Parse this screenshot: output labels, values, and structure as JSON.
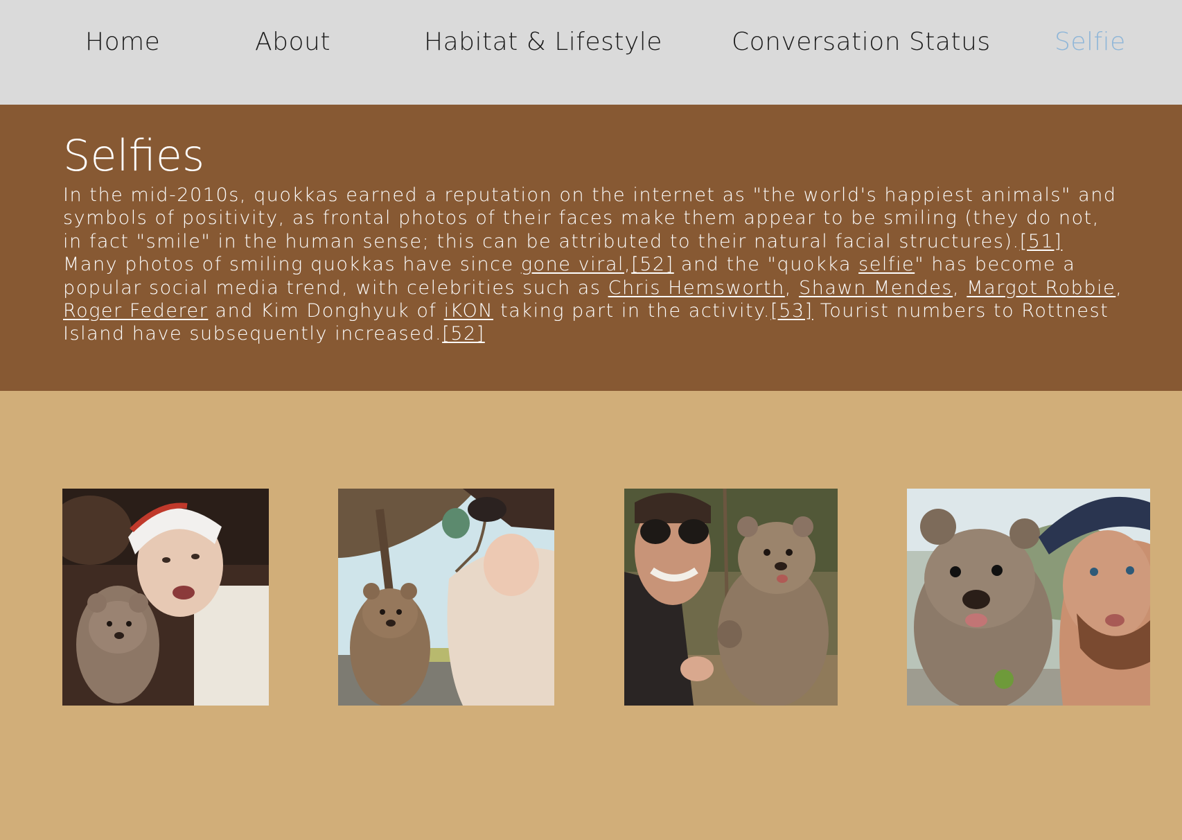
{
  "nav": {
    "items": [
      {
        "label": "Home"
      },
      {
        "label": "About"
      },
      {
        "label": "Habitat & Lifestyle"
      },
      {
        "label": "Conversation Status"
      },
      {
        "label": "Selfie"
      }
    ]
  },
  "section": {
    "title": "Selfies",
    "p": {
      "t1": "In the mid-2010s, quokkas earned a reputation on the internet as \"the world's happiest animals\" and symbols of positivity, as frontal photos of their faces make them appear to be smiling (they do not, in fact \"smile\" in the human sense; this can be attributed to their natural facial structures).",
      "ref51": "[51]",
      "t2": " Many photos of smiling quokkas have since ",
      "gone_viral": "gone viral",
      "t3": ",",
      "ref52a": "[52]",
      "t4": " and the \"quokka ",
      "selfie": "selfie",
      "t5": "\" has become a popular social media trend, with celebrities such as ",
      "chris": "Chris Hemsworth",
      "t6": ", ",
      "shawn": "Shawn Mendes",
      "t7": ", ",
      "margot": "Margot Robbie",
      "t8": ", ",
      "roger": "Roger Federer",
      "t9": " and Kim Donghyuk of ",
      "ikon": "iKON",
      "t10": " taking part in the activity.",
      "ref53": "[53]",
      "t11": " Tourist numbers to Rottnest Island have subsequently increased.",
      "ref52b": "[52]"
    }
  },
  "photos": [
    {
      "name": "selfie-photo-1"
    },
    {
      "name": "selfie-photo-2"
    },
    {
      "name": "selfie-photo-3"
    },
    {
      "name": "selfie-photo-4"
    }
  ],
  "colors": {
    "nav_bg": "#dadada",
    "active_link": "#8fb6d8",
    "hero_bg": "#875933",
    "page_bg": "#d1ae79"
  }
}
